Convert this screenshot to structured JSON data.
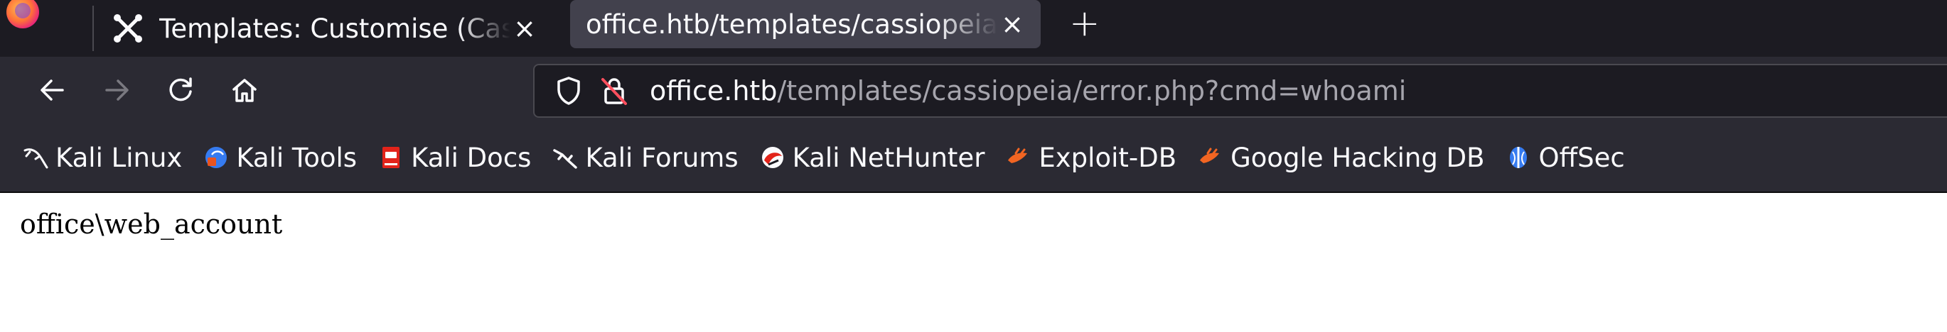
{
  "tabs": [
    {
      "title": "Templates: Customise (Cassiopeia)",
      "close": "×"
    },
    {
      "title": "office.htb/templates/cassiopeia/error.php?cmd=whoami",
      "close": "×"
    }
  ],
  "new_tab_label": "+",
  "url": {
    "host": "office.htb",
    "path": "/templates/cassiopeia/error.php?cmd=whoami"
  },
  "bookmarks": [
    {
      "label": "Kali Linux",
      "icon": "kali-dragon-icon"
    },
    {
      "label": "Kali Tools",
      "icon": "kali-tools-icon"
    },
    {
      "label": "Kali Docs",
      "icon": "kali-docs-icon"
    },
    {
      "label": "Kali Forums",
      "icon": "kali-forums-icon"
    },
    {
      "label": "Kali NetHunter",
      "icon": "kali-nethunter-icon"
    },
    {
      "label": "Exploit-DB",
      "icon": "exploit-db-icon"
    },
    {
      "label": "Google Hacking DB",
      "icon": "ghdb-icon"
    },
    {
      "label": "OffSec",
      "icon": "offsec-icon"
    }
  ],
  "page": {
    "output": "office\\web_account"
  },
  "colors": {
    "tabstrip": "#1c1b22",
    "toolbar": "#2b2a33",
    "selected_tab": "#42414d",
    "text": "#fbfbfe",
    "url_path": "#a6a5ad"
  }
}
